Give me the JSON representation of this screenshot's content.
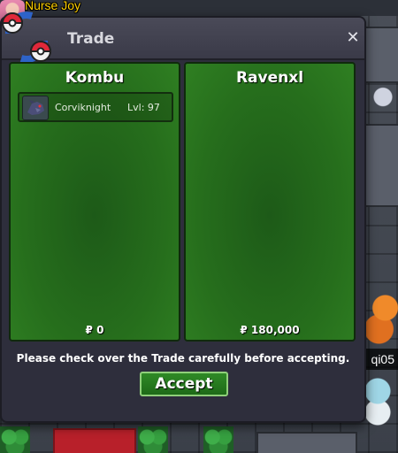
{
  "world": {
    "npc_name": "Nurse Joy",
    "player_tag": "qi05"
  },
  "trade": {
    "title": "Trade",
    "close_icon": "close-icon",
    "left_trader": {
      "name": "Kombu",
      "items": [
        {
          "pokemon": "Corviknight",
          "level": "Lvl: 97",
          "icon": "corviknight-sprite-icon"
        }
      ],
      "money": "₽ 0"
    },
    "right_trader": {
      "name": "Ravenxl",
      "items": [],
      "money": "₽ 180,000"
    },
    "notice": "Please check over the Trade carefully before accepting.",
    "accept_label": "Accept"
  },
  "colors": {
    "panel_green": "#266e1c",
    "window_bg": "#2e2e3c",
    "accept_green": "#2f8a26",
    "npc_name_color": "#ffd000"
  }
}
